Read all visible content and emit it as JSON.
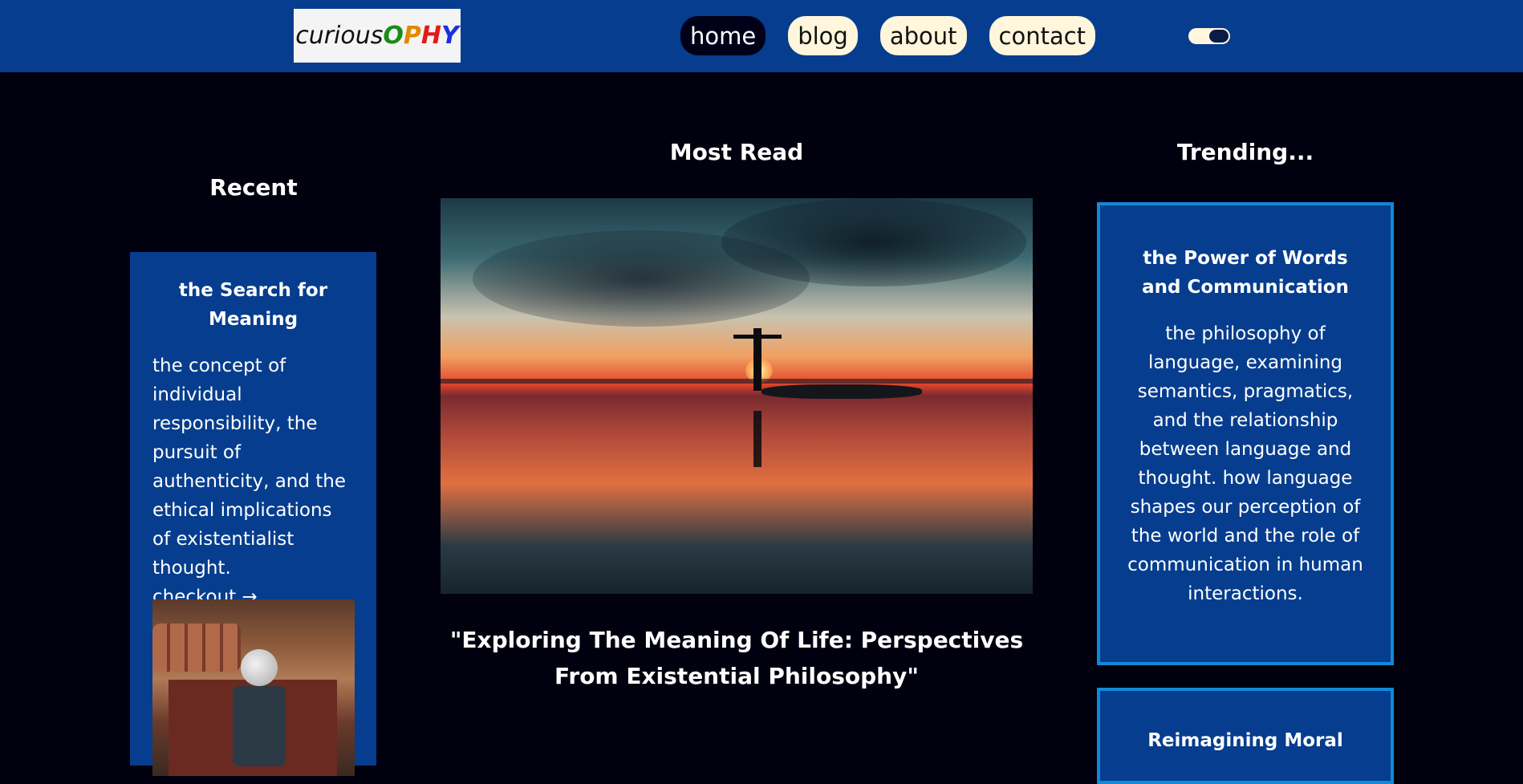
{
  "header": {
    "logo": {
      "prefix": "curious",
      "o": "O",
      "p": "P",
      "h": "H",
      "y": "Y"
    },
    "nav": [
      {
        "label": "home",
        "active": true
      },
      {
        "label": "blog",
        "active": false
      },
      {
        "label": "about",
        "active": false
      },
      {
        "label": "contact",
        "active": false
      }
    ],
    "theme_toggle": {
      "icon": "toggle-icon"
    }
  },
  "sections": {
    "recent": "Recent",
    "most_read": "Most Read",
    "trending": "Trending..."
  },
  "recent_card": {
    "title": "the Search for Meaning",
    "body": "the concept of individual responsibility, the pursuit of authenticity, and the ethical implications of existentialist thought.",
    "link": "checkout →"
  },
  "most_read": {
    "caption": "\"Exploring The Meaning Of Life: Perspectives From Existential Philosophy\""
  },
  "trending": [
    {
      "title": "the Power of Words and Communication",
      "body": "the philosophy of language, examining semantics, pragmatics, and the relationship between language and thought. how language shapes our perception of the world and the role of communication in human interactions."
    },
    {
      "title": "Reimagining Moral"
    }
  ],
  "colors": {
    "header_bg": "#063d8e",
    "page_bg": "#00000f",
    "card_bg": "#063d8e",
    "card_border": "#1288d8",
    "pill_bg": "#fff6dc",
    "pill_active_bg": "#000018"
  }
}
